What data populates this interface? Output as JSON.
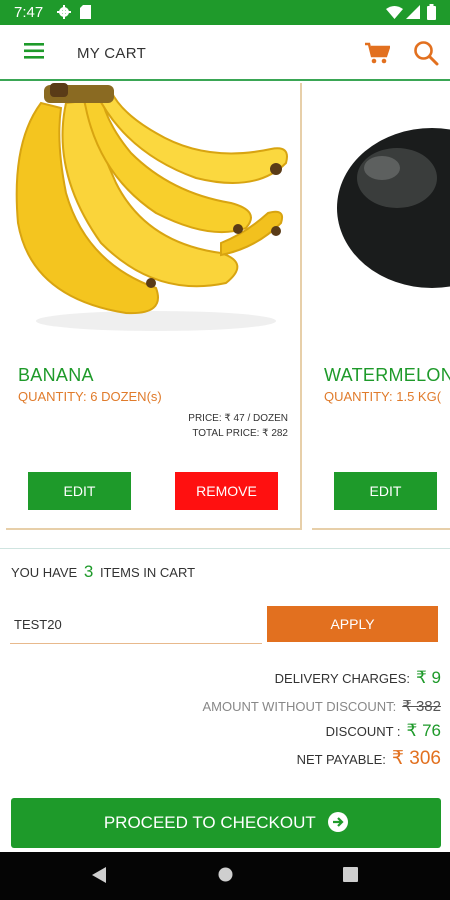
{
  "status_bar": {
    "time": "7:47",
    "icons": [
      "settings-icon",
      "sd-card-icon",
      "wifi-icon",
      "signal-icon",
      "battery-icon"
    ]
  },
  "app_bar": {
    "title": "MY CART",
    "icons": [
      "menu-icon",
      "cart-icon",
      "search-icon"
    ],
    "accent_color": "#e2701f"
  },
  "products": [
    {
      "name": "BANANA",
      "quantity": "QUANTITY: 6 DOZEN(s)",
      "price": "PRICE: ₹ 47 / DOZEN",
      "total_price": "TOTAL PRICE: ₹ 282",
      "edit_label": "EDIT",
      "remove_label": "REMOVE",
      "image": "banana-bunch"
    },
    {
      "name": "WATERMELON",
      "quantity": "QUANTITY: 1.5 KG(",
      "edit_label": "EDIT",
      "image": "watermelon"
    }
  ],
  "cart": {
    "items_prefix": "YOU HAVE",
    "items_count": "3",
    "items_suffix": "ITEMS IN CART",
    "coupon_value": "TEST20",
    "apply_label": "APPLY"
  },
  "summary": {
    "delivery_label": "DELIVERY CHARGES:",
    "delivery_value": "₹ 9",
    "amount_label": "AMOUNT WITHOUT DISCOUNT:",
    "amount_value": "₹ 382",
    "discount_label": "DISCOUNT :",
    "discount_value": "₹ 76",
    "net_label": "NET PAYABLE:",
    "net_value": "₹ 306"
  },
  "checkout": {
    "label": "PROCEED TO CHECKOUT"
  },
  "colors": {
    "primary_green": "#1e9a2a",
    "status_green": "#1f9a2b",
    "orange": "#e2701f",
    "remove_red": "#ff1010"
  }
}
